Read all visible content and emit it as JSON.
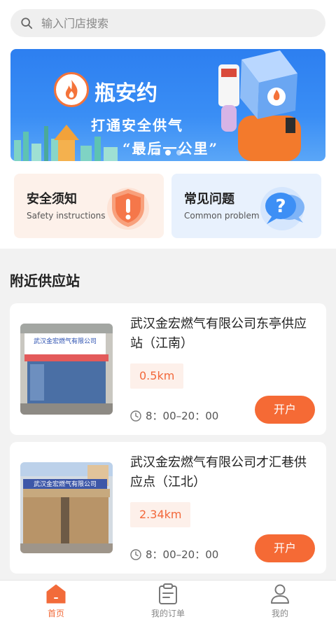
{
  "search": {
    "placeholder": "输入门店搜索",
    "icon": "search-icon"
  },
  "banner": {
    "brand": "瓶安约",
    "slogan_line1": "打通安全供气",
    "slogan_line2": "“最后一公里”",
    "active_dot": 1,
    "dot_count": 3
  },
  "quick_cards": [
    {
      "title": "安全须知",
      "subtitle": "Safety instructions",
      "icon": "shield-exclamation-icon",
      "color": "#f5774a"
    },
    {
      "title": "常见问题",
      "subtitle": "Common problem",
      "icon": "question-chat-icon",
      "color": "#3d8ff5"
    }
  ],
  "section": {
    "title": "附近供应站"
  },
  "stations": [
    {
      "name": "武汉金宏燃气有限公司东亭供应站（江南）",
      "distance": "0.5km",
      "hours": "8：00–20：00",
      "action": "开户",
      "sign_text": "武汉金宏燃气有限公司"
    },
    {
      "name": "武汉金宏燃气有限公司才汇巷供应点（江北）",
      "distance": "2.34km",
      "hours": "8：00–20：00",
      "action": "开户",
      "sign_text": "武汉金宏燃气有限公司"
    }
  ],
  "tabbar": [
    {
      "label": "首页",
      "icon": "home-icon",
      "active": true
    },
    {
      "label": "我的订单",
      "icon": "clipboard-icon",
      "active": false
    },
    {
      "label": "我的",
      "icon": "user-icon",
      "active": false
    }
  ],
  "colors": {
    "accent": "#f56a35",
    "banner_blue": "#2d7ff0",
    "background": "#f2f2f2"
  }
}
